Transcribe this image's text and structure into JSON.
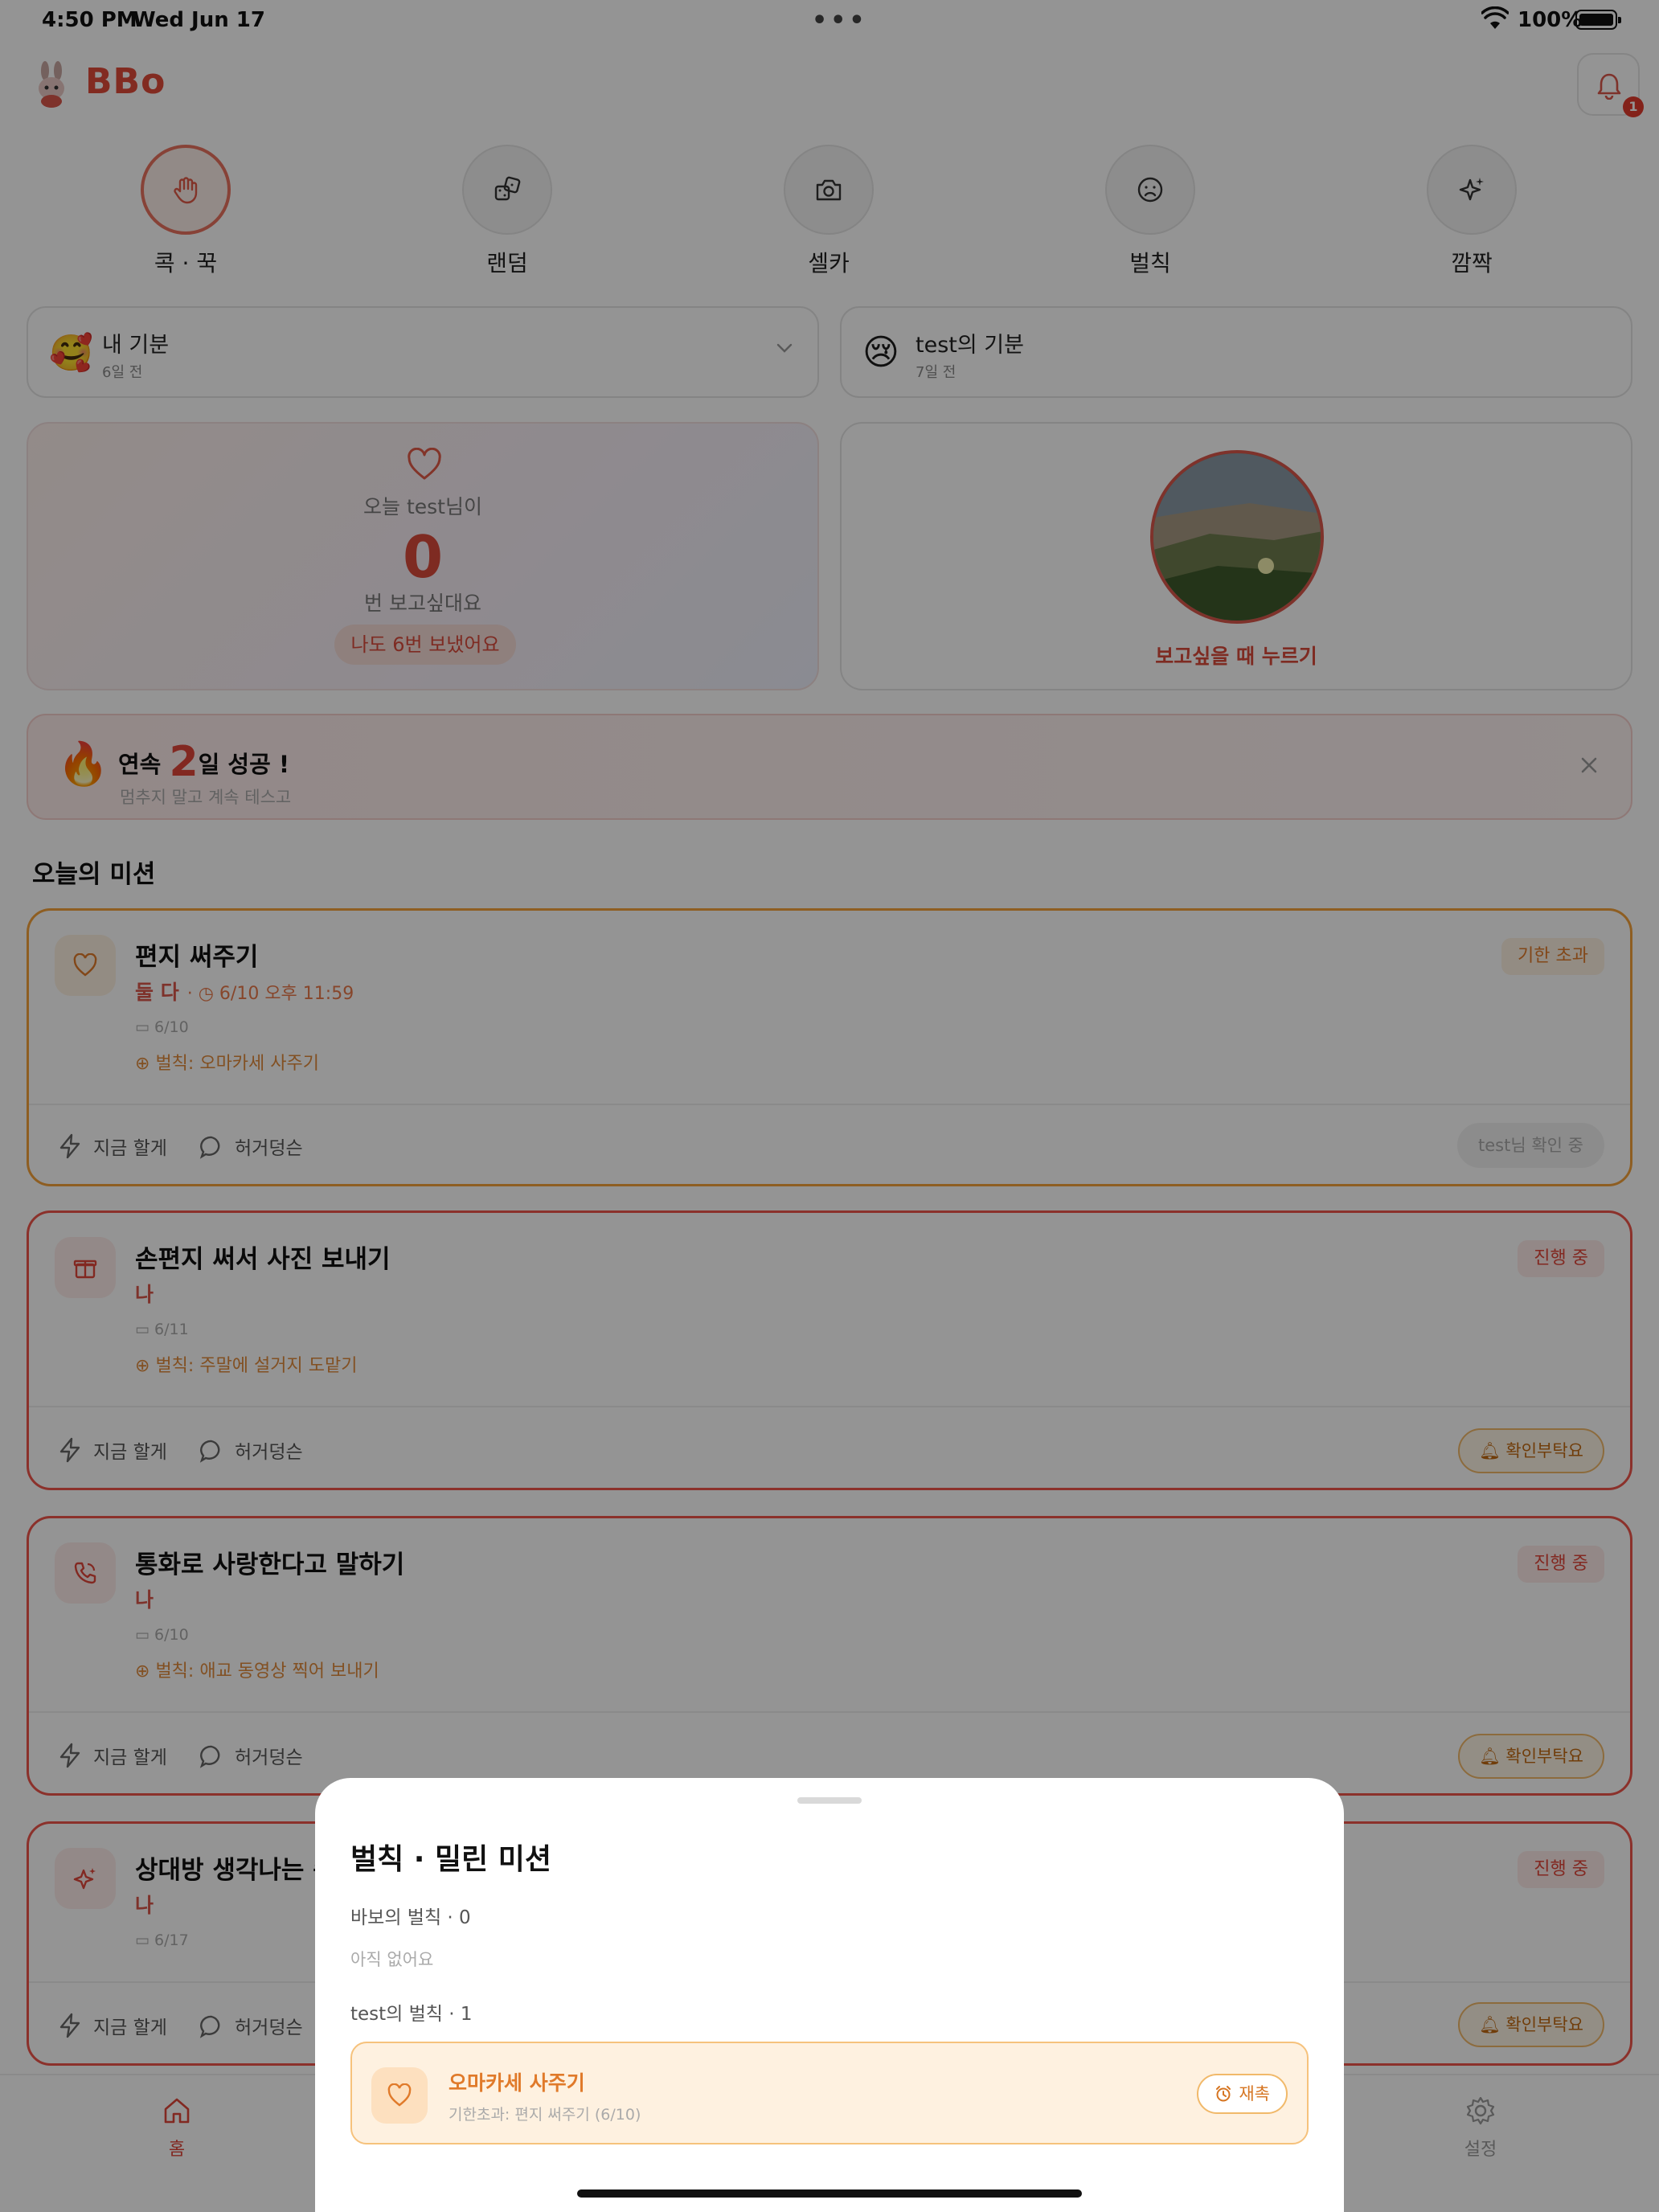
{
  "status_bar": {
    "time": "4:50 PM",
    "date": "Wed Jun 17",
    "battery": "100%"
  },
  "header": {
    "brand": "BBo",
    "notification_count": "1"
  },
  "quick_actions": [
    {
      "label": "콕 · 꾹",
      "icon": "hand-icon",
      "active": true
    },
    {
      "label": "랜덤",
      "icon": "dice-icon",
      "active": false
    },
    {
      "label": "셀카",
      "icon": "camera-icon",
      "active": false
    },
    {
      "label": "벌칙",
      "icon": "frown-icon",
      "active": false
    },
    {
      "label": "깜짝",
      "icon": "sparkle-icon",
      "active": false
    }
  ],
  "mood": {
    "mine": {
      "emoji": "🥰",
      "title": "내 기분",
      "time": "6일 전"
    },
    "partner": {
      "emoji": "😢",
      "title": "test의 기분",
      "time": "7일 전"
    }
  },
  "miss_card": {
    "line1": "오늘 test님이",
    "count": "0",
    "line2": "번 보고싶대요",
    "pill": "나도 6번 보냈어요"
  },
  "photo_card": {
    "press_label": "보고싶을 때 누르기"
  },
  "streak": {
    "prefix": "연속 ",
    "days": "2",
    "suffix": "일 성공 !",
    "sub": "멈추지 말고 계속 테스고"
  },
  "section_title": "오늘의 미션",
  "missions": [
    {
      "title": "편지 써주기",
      "who": "둘 다",
      "deadline": "6/10 오후 11:59",
      "date": "6/10",
      "penalty": "벌칙: 오마카세 사주기",
      "status": "기한 초과",
      "action1": "지금 할게",
      "action2": "허거덩슨",
      "right_pill": "test님 확인 중"
    },
    {
      "title": "손편지 써서 사진 보내기",
      "who": "나",
      "date": "6/11",
      "penalty": "벌칙: 주말에 설거지 도맡기",
      "status": "진행 중",
      "action1": "지금 할게",
      "action2": "허거덩슨",
      "right_pill": "확인부탁요"
    },
    {
      "title": "통화로 사랑한다고 말하기",
      "who": "나",
      "date": "6/10",
      "penalty": "벌칙: 애교 동영상 찍어 보내기",
      "status": "진행 중",
      "action1": "지금 할게",
      "action2": "허거덩슨",
      "right_pill": "확인부탁요"
    },
    {
      "title": "상대방 생각나는 순",
      "who": "나",
      "date": "6/17",
      "status": "진행 중",
      "action1": "지금 할게",
      "action2": "허거덩슨",
      "right_pill": "확인부탁요"
    }
  ],
  "nav": {
    "home": "홈",
    "settings": "설정"
  },
  "sheet": {
    "title": "벌칙 · 밀린 미션",
    "my_section": "바보의 벌칙 · 0",
    "my_empty": "아직 없어요",
    "partner_section": "test의 벌칙 · 1",
    "item": {
      "title": "오마카세 사주기",
      "sub": "기한초과: 편지 써주기",
      "sub_date": "(6/10)",
      "button": "재촉"
    }
  },
  "colors": {
    "accent": "#e0463a",
    "orange": "#e07a2a",
    "overlay": "rgba(0,0,0,0.42)"
  }
}
